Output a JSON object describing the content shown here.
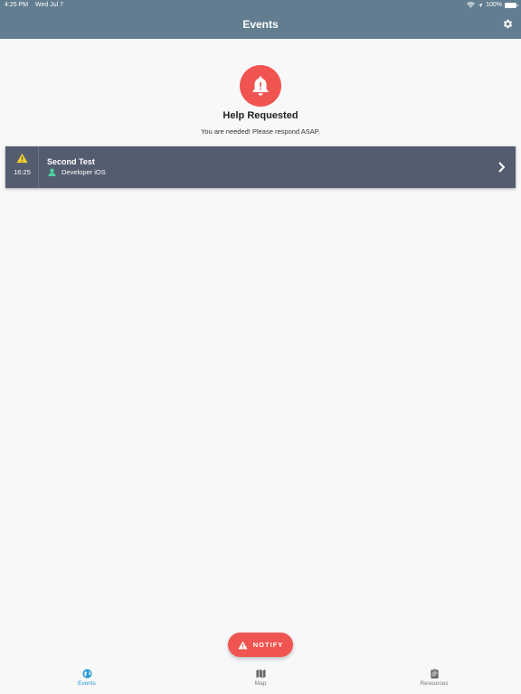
{
  "status_bar": {
    "time": "4:25 PM",
    "date": "Wed Jul 7",
    "battery": "100%"
  },
  "header": {
    "title": "Events",
    "settings_icon": "gear-icon"
  },
  "alert": {
    "icon": "bell-icon",
    "title": "Help Requested",
    "subtitle": "You are needed! Please respond ASAP."
  },
  "events": [
    {
      "icon": "warning-icon",
      "time": "16:25",
      "title": "Second Test",
      "user": "Developer iOS"
    }
  ],
  "notify_button": {
    "label": "NOTIFY",
    "icon": "warning-icon"
  },
  "tabs": [
    {
      "label": "Events",
      "icon": "globe-icon",
      "active": true
    },
    {
      "label": "Map",
      "icon": "map-icon",
      "active": false
    },
    {
      "label": "Resources",
      "icon": "clipboard-icon",
      "active": false
    }
  ],
  "colors": {
    "header": "#617d8f",
    "accent_red": "#f05451",
    "event_row": "#545c6f",
    "active_tab": "#2a9bd4",
    "warning": "#f5d32a",
    "user_icon": "#4fd1a0"
  }
}
